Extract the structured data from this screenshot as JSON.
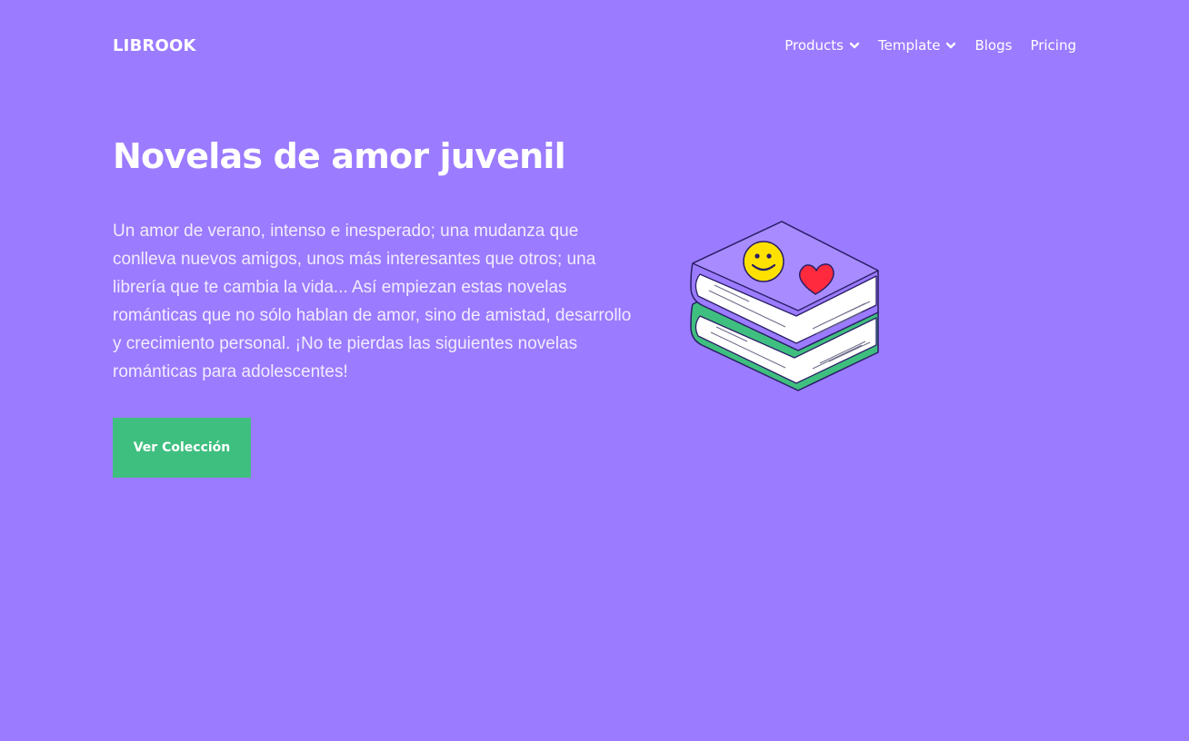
{
  "brand": {
    "name": "LIBROOK"
  },
  "nav": {
    "items": [
      {
        "label": "Products",
        "dropdown": true
      },
      {
        "label": "Template",
        "dropdown": true
      },
      {
        "label": "Blogs",
        "dropdown": false
      },
      {
        "label": "Pricing",
        "dropdown": false
      }
    ]
  },
  "hero": {
    "title": "Novelas de amor juvenil",
    "description": "Un amor de verano, intenso e inesperado; una mudanza que conlleva nuevos amigos, unos más interesantes que otros; una librería que te cambia la vida... Así empiezan estas novelas románticas que no sólo hablan de amor, sino de amistad, desarrollo y crecimiento personal. ¡No te pierdas las siguientes novelas románticas para adolescentes!",
    "cta_label": "Ver Colección"
  },
  "colors": {
    "background": "#9b7bff",
    "cta": "#3fbf7f",
    "text": "#ffffff"
  },
  "icons": {
    "illustration": "stacked-books-illustration",
    "dropdown": "chevron-down-icon"
  }
}
